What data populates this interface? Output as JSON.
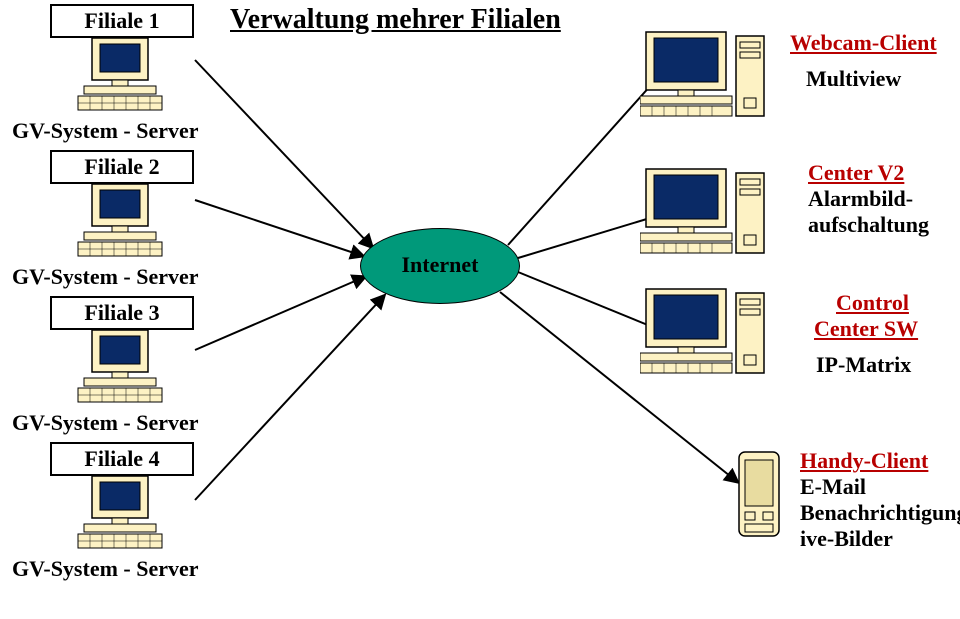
{
  "title": "Verwaltung mehrer Filialen",
  "internet": "Internet",
  "left": [
    {
      "box": "Filiale 1",
      "caption": "GV-System - Server"
    },
    {
      "box": "Filiale 2",
      "caption": "GV-System - Server"
    },
    {
      "box": "Filiale 3",
      "caption": "GV-System - Server"
    },
    {
      "box": "Filiale 4",
      "caption": "GV-System - Server"
    }
  ],
  "right": {
    "webcam": {
      "line1": "Webcam-Client",
      "line2": "Multiview"
    },
    "centerv2": {
      "line1": "Center V2",
      "line2": "Alarmbild-",
      "line3": "aufschaltung"
    },
    "control": {
      "line1": "Control",
      "line2": "Center SW",
      "line3": "IP-Matrix"
    },
    "handy": {
      "line1": "Handy-Client",
      "line2": "E-Mail",
      "line3": "BenachrichtigungL",
      "line4": "ive-Bilder"
    }
  }
}
